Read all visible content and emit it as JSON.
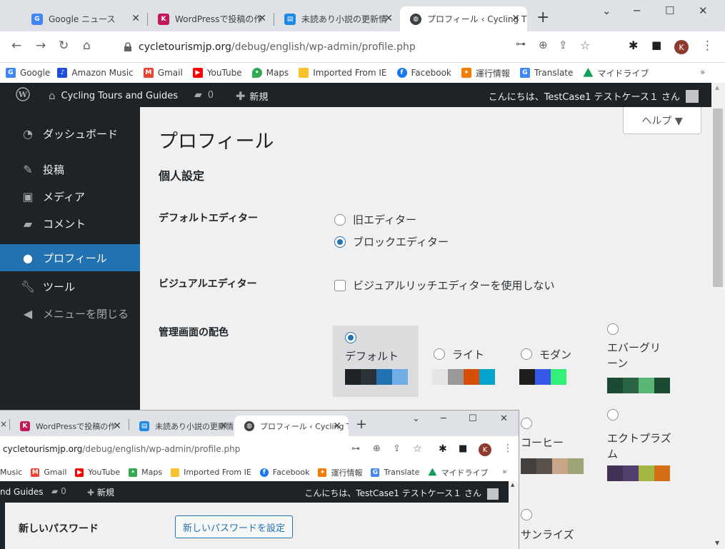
{
  "browser": {
    "tabs": [
      {
        "title": "Google ニュース",
        "icon": "google-news-icon"
      },
      {
        "title": "WordPressで投稿の作",
        "icon": "wordpress-k-icon"
      },
      {
        "title": "未読あり小説の更新情",
        "icon": "novel-icon"
      },
      {
        "title": "プロフィール ‹ Cycling T",
        "icon": "globe-icon",
        "active": true
      }
    ],
    "url_host": "cycletourismjp.org",
    "url_path": "/debug/english/wp-admin/profile.php",
    "profile_initial": "K",
    "bookmarks": [
      {
        "label": "Google",
        "icon": "google-icon",
        "color": "#4285f4"
      },
      {
        "label": "Amazon Music",
        "icon": "amazon-music-icon",
        "color": "#1d4ed8"
      },
      {
        "label": "Gmail",
        "icon": "gmail-icon",
        "color": "#ea4335"
      },
      {
        "label": "YouTube",
        "icon": "youtube-icon",
        "color": "#ff0000"
      },
      {
        "label": "Maps",
        "icon": "maps-icon",
        "color": "#34a853"
      },
      {
        "label": "Imported From IE",
        "icon": "folder-icon",
        "color": "#fbc02d"
      },
      {
        "label": "Facebook",
        "icon": "facebook-icon",
        "color": "#1877f2"
      },
      {
        "label": "運行情報",
        "icon": "train-info-icon",
        "color": "#f57c00"
      },
      {
        "label": "Translate",
        "icon": "translate-icon",
        "color": "#4285f4"
      },
      {
        "label": "マイドライブ",
        "icon": "google-drive-icon",
        "color": "#0f9d58"
      }
    ],
    "more_bookmarks": "»"
  },
  "adminbar": {
    "site_name": "Cycling Tours and Guides",
    "comments_count": "0",
    "new_label": "新規",
    "greeting": "こんにちは、TestCase1 テストケース１ さん"
  },
  "sidebar": {
    "items": [
      {
        "label": "ダッシュボード",
        "icon": "dashboard-icon"
      },
      {
        "label": "投稿",
        "icon": "pin-icon"
      },
      {
        "label": "メディア",
        "icon": "media-icon"
      },
      {
        "label": "コメント",
        "icon": "comment-icon"
      },
      {
        "label": "プロフィール",
        "icon": "user-icon",
        "current": true
      },
      {
        "label": "ツール",
        "icon": "wrench-icon"
      },
      {
        "label": "メニューを閉じる",
        "icon": "collapse-icon"
      }
    ]
  },
  "main": {
    "help_label": "ヘルプ ▼",
    "page_title": "プロフィール",
    "section_title": "個人設定",
    "default_editor": {
      "label": "デフォルトエディター",
      "options": [
        "旧エディター",
        "ブロックエディター"
      ],
      "selected": "ブロックエディター"
    },
    "visual_editor": {
      "label": "ビジュアルエディター",
      "checkbox_label": "ビジュアルリッチエディターを使用しない",
      "checked": false
    },
    "color_scheme": {
      "label": "管理画面の配色",
      "selected": "デフォルト",
      "schemes": [
        {
          "name": "デフォルト",
          "colors": [
            "#1d2327",
            "#2c3338",
            "#2271b1",
            "#72aee6"
          ]
        },
        {
          "name": "ライト",
          "colors": [
            "#e5e5e5",
            "#999999",
            "#d64e07",
            "#04a4cc"
          ]
        },
        {
          "name": "モダン",
          "colors": [
            "#1e1e1e",
            "#3858e9",
            "#33f078",
            "#33f078"
          ]
        },
        {
          "name": "エバーグリーン",
          "colors": [
            "#1a4a32",
            "#2b6444",
            "#5bb675",
            "#1a4a32"
          ]
        },
        {
          "name": "コーヒー",
          "colors": [
            "#46403c",
            "#59524c",
            "#c7a589",
            "#9ea476"
          ]
        },
        {
          "name": "エクトプラズム",
          "colors": [
            "#413256",
            "#523f6d",
            "#a3b745",
            "#d46f15"
          ]
        },
        {
          "name": "サンライズ",
          "colors": []
        }
      ]
    }
  },
  "overlay": {
    "tabs": [
      {
        "title": "WordPressで投稿の作"
      },
      {
        "title": "未読あり小説の更新情"
      },
      {
        "title": "プロフィール ‹ Cycling T"
      }
    ],
    "url_host": "cycletourismjp.org",
    "url_path": "/debug/english/wp-admin/profile.php",
    "bookmarks": [
      "Music",
      "Gmail",
      "YouTube",
      "Maps",
      "Imported From IE",
      "Facebook",
      "運行情報",
      "Translate",
      "マイドライブ"
    ],
    "site_name_partial": "nd Guides",
    "comments_count": "0",
    "new_label": "新規",
    "greeting": "こんにちは、TestCase1 テストケース１ さん",
    "new_password_label": "新しいパスワード",
    "set_password_button": "新しいパスワードを設定"
  }
}
